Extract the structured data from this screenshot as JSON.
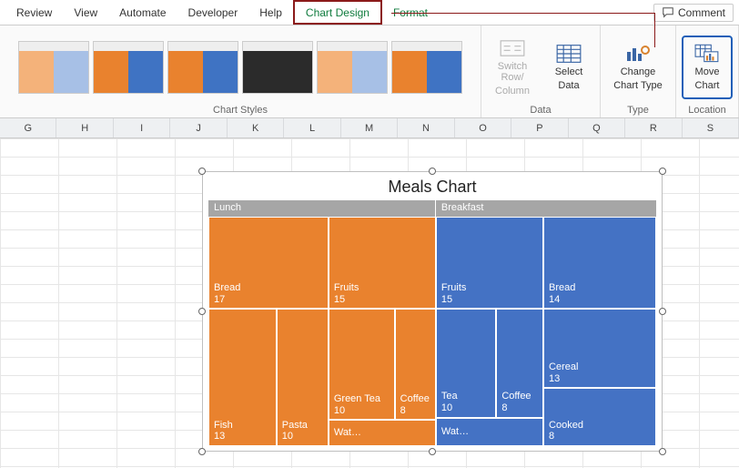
{
  "tabs": {
    "review": "Review",
    "view": "View",
    "automate": "Automate",
    "developer": "Developer",
    "help": "Help",
    "chart_design": "Chart Design",
    "format": "Format"
  },
  "comment_label": "Comment",
  "ribbon": {
    "groups": {
      "chart_styles": "Chart Styles",
      "data": "Data",
      "type": "Type",
      "location": "Location"
    },
    "switch_row_col_l1": "Switch Row/",
    "switch_row_col_l2": "Column",
    "select_data_l1": "Select",
    "select_data_l2": "Data",
    "change_type_l1": "Change",
    "change_type_l2": "Chart Type",
    "move_chart_l1": "Move",
    "move_chart_l2": "Chart"
  },
  "columns": [
    "G",
    "H",
    "I",
    "J",
    "K",
    "L",
    "M",
    "N",
    "O",
    "P",
    "Q",
    "R",
    "S"
  ],
  "chart": {
    "title": "Meals Chart",
    "cat_lunch": "Lunch",
    "cat_breakfast": "Breakfast",
    "lunch": {
      "bread_l": "Bread",
      "bread_v": "17",
      "fish_l": "Fish",
      "fish_v": "13",
      "pasta_l": "Pasta",
      "pasta_v": "10",
      "fruits_l": "Fruits",
      "fruits_v": "15",
      "greentea_l": "Green Tea",
      "greentea_v": "10",
      "coffee_l": "Coffee",
      "coffee_v": "8",
      "water_l": "Wat…"
    },
    "breakfast": {
      "fruits_l": "Fruits",
      "fruits_v": "15",
      "bread_l": "Bread",
      "bread_v": "14",
      "tea_l": "Tea",
      "tea_v": "10",
      "coffee_l": "Coffee",
      "coffee_v": "8",
      "cereal_l": "Cereal",
      "cereal_v": "13",
      "cooked_l": "Cooked",
      "cooked_v": "8",
      "water_l": "Wat…"
    }
  },
  "chart_data": {
    "type": "treemap",
    "title": "Meals Chart",
    "series": [
      {
        "name": "Lunch",
        "color": "#e9822e",
        "items": [
          {
            "label": "Bread",
            "value": 17
          },
          {
            "label": "Fruits",
            "value": 15
          },
          {
            "label": "Fish",
            "value": 13
          },
          {
            "label": "Pasta",
            "value": 10
          },
          {
            "label": "Green Tea",
            "value": 10
          },
          {
            "label": "Coffee",
            "value": 8
          },
          {
            "label": "Water",
            "value": 5
          }
        ]
      },
      {
        "name": "Breakfast",
        "color": "#4472c4",
        "items": [
          {
            "label": "Fruits",
            "value": 15
          },
          {
            "label": "Bread",
            "value": 14
          },
          {
            "label": "Cereal",
            "value": 13
          },
          {
            "label": "Tea",
            "value": 10
          },
          {
            "label": "Coffee",
            "value": 8
          },
          {
            "label": "Cooked",
            "value": 8
          },
          {
            "label": "Water",
            "value": 5
          }
        ]
      }
    ]
  }
}
